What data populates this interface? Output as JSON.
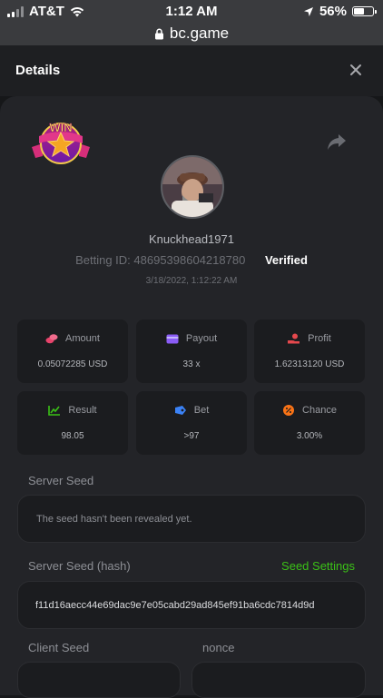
{
  "status_bar": {
    "carrier": "AT&T",
    "time": "1:12 AM",
    "battery": "56%",
    "battery_level": 0.56
  },
  "url_bar": {
    "domain": "bc.game"
  },
  "modal": {
    "title": "Details"
  },
  "win_badge": {
    "text": "WIN"
  },
  "player": {
    "username": "Knuckhead1971",
    "betting_id_label": "Betting ID:",
    "betting_id": "48695398604218780",
    "verified": "Verified",
    "date": "3/18/2022, 1:12:22 AM"
  },
  "stats": [
    {
      "label": "Amount",
      "value": "0.05072285 USD",
      "icon": "coins-icon",
      "color": "#e8436b"
    },
    {
      "label": "Payout",
      "value": "33 x",
      "icon": "wallet-icon",
      "color": "#8b5cf6"
    },
    {
      "label": "Profit",
      "value": "1.62313120 USD",
      "icon": "hand-money-icon",
      "color": "#e5484d"
    },
    {
      "label": "Result",
      "value": "98.05",
      "icon": "chart-up-icon",
      "color": "#3bc117"
    },
    {
      "label": "Bet",
      "value": ">97",
      "icon": "ticket-icon",
      "color": "#3b82f6"
    },
    {
      "label": "Chance",
      "value": "3.00%",
      "icon": "percent-icon",
      "color": "#f97316"
    }
  ],
  "server_seed": {
    "label": "Server Seed",
    "value": "The seed hasn't been revealed yet."
  },
  "server_seed_hash": {
    "label": "Server Seed (hash)",
    "link": "Seed Settings",
    "value": "f11d16aecc44e69dac9e7e05cabd29ad845ef91ba6cdc7814d9d"
  },
  "client_seed": {
    "label": "Client Seed"
  },
  "nonce": {
    "label": "nonce"
  }
}
